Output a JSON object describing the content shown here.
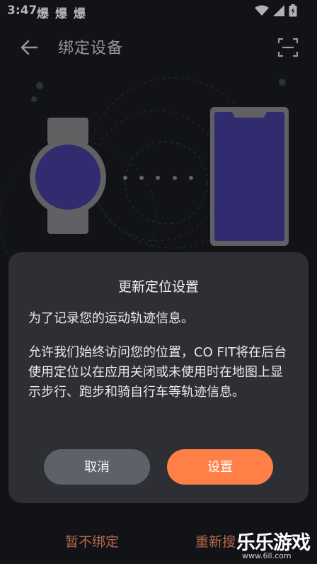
{
  "status_bar": {
    "time": "3:47",
    "notif": [
      "爆",
      "爆",
      "爆"
    ],
    "icons": [
      "wifi-icon",
      "signal-icon",
      "battery-icon"
    ]
  },
  "header": {
    "title": "绑定设备",
    "back_icon": "back-arrow-icon",
    "scan_icon": "scan-icon"
  },
  "illustration": {
    "watch_icon": "smartwatch-icon",
    "phone_icon": "smartphone-icon",
    "accent": "#473ea1"
  },
  "dialog": {
    "title": "更新定位设置",
    "p1": "为了记录您的运动轨迹信息。",
    "p2": "允许我们始终访问您的位置，CO FIT将在后台使用定位以在应用关闭或未使用时在地图上显示步行、跑步和骑自行车等轨迹信息。",
    "cancel_label": "取消",
    "settings_label": "设置"
  },
  "footer": {
    "left_label": "暂不绑定",
    "right_label": "重新搜"
  },
  "watermark": {
    "main": "乐乐游戏",
    "sub": "www.6ll.com"
  },
  "colors": {
    "background": "#191c22",
    "dialog": "#2d2f34",
    "accent": "#ff7f47",
    "cancel": "#5e6167"
  }
}
